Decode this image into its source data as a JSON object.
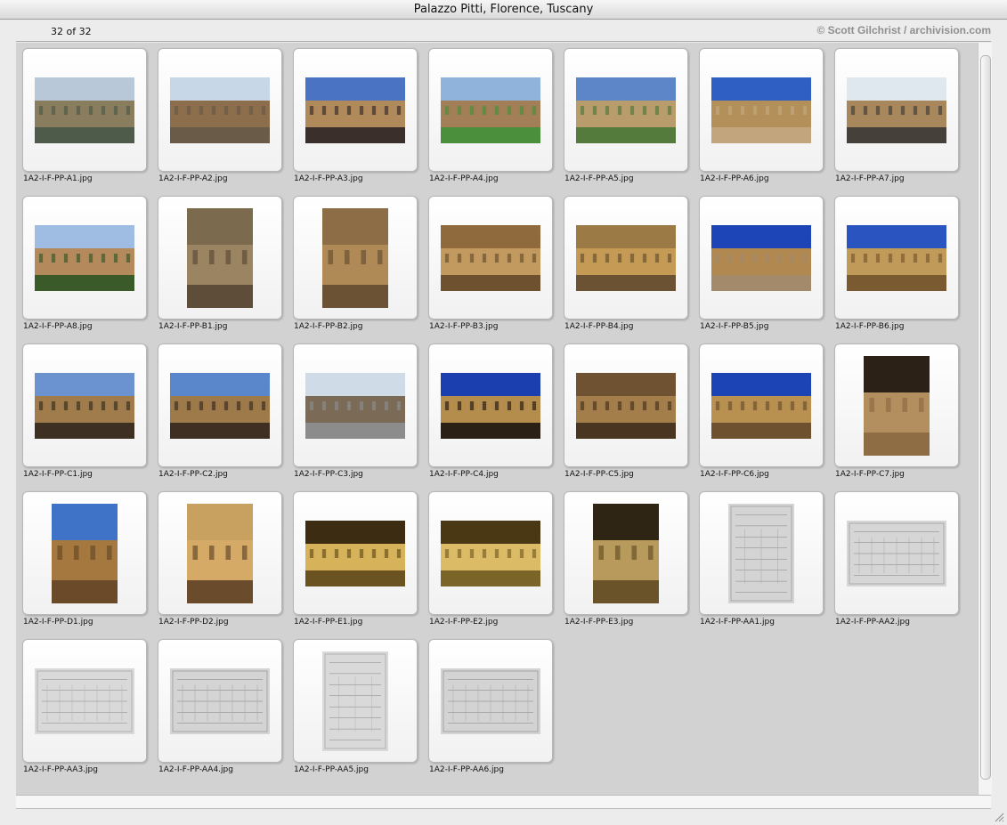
{
  "window": {
    "title": "Palazzo Pitti, Florence, Tuscany"
  },
  "header": {
    "count": "32 of 32",
    "copyright": "© Scott Gilchrist / archivision.com"
  },
  "thumbnails": [
    {
      "filename": "1A2-I-F-PP-A1.jpg",
      "kind": "photo",
      "orientation": "landscape",
      "sky": "#b9c8d8",
      "ground": "#4f5b4a",
      "accent": "#8a7d5e",
      "icon": "city-panorama-icon"
    },
    {
      "filename": "1A2-I-F-PP-A2.jpg",
      "kind": "photo",
      "orientation": "landscape",
      "sky": "#c7d7e7",
      "ground": "#6a5a48",
      "accent": "#8d6e4c",
      "icon": "palace-street-icon"
    },
    {
      "filename": "1A2-I-F-PP-A3.jpg",
      "kind": "photo",
      "orientation": "landscape",
      "sky": "#4a73c4",
      "ground": "#3b2f2b",
      "accent": "#b08a5b",
      "icon": "piazza-facade-icon"
    },
    {
      "filename": "1A2-I-F-PP-A4.jpg",
      "kind": "photo",
      "orientation": "landscape",
      "sky": "#8fb3db",
      "ground": "#4b8f3d",
      "accent": "#a27f56",
      "icon": "palace-garden-icon"
    },
    {
      "filename": "1A2-I-F-PP-A5.jpg",
      "kind": "photo",
      "orientation": "landscape",
      "sky": "#5d86c9",
      "ground": "#547a3c",
      "accent": "#b89c6c",
      "icon": "city-view-icon"
    },
    {
      "filename": "1A2-I-F-PP-A6.jpg",
      "kind": "photo",
      "orientation": "landscape",
      "sky": "#2f5fc2",
      "ground": "#c2a57c",
      "accent": "#b38f59",
      "icon": "palace-courtyard-icon"
    },
    {
      "filename": "1A2-I-F-PP-A7.jpg",
      "kind": "photo",
      "orientation": "landscape",
      "sky": "#dfe8ee",
      "ground": "#45403a",
      "accent": "#a8875d",
      "icon": "palace-wing-icon"
    },
    {
      "filename": "1A2-I-F-PP-A8.jpg",
      "kind": "photo",
      "orientation": "landscape",
      "sky": "#9fbde3",
      "ground": "#3b5a2a",
      "accent": "#b48a5c",
      "icon": "palace-hillside-icon"
    },
    {
      "filename": "1A2-I-F-PP-B1.jpg",
      "kind": "photo",
      "orientation": "portrait",
      "sky": "#7c6a4e",
      "ground": "#5e4d38",
      "accent": "#9a8461",
      "icon": "rusticated-wall-icon"
    },
    {
      "filename": "1A2-I-F-PP-B2.jpg",
      "kind": "photo",
      "orientation": "portrait",
      "sky": "#8c6d45",
      "ground": "#6b5234",
      "accent": "#b08a56",
      "icon": "window-detail-icon"
    },
    {
      "filename": "1A2-I-F-PP-B3.jpg",
      "kind": "photo",
      "orientation": "landscape",
      "sky": "#8e6a3d",
      "ground": "#6e5230",
      "accent": "#c29a5f",
      "icon": "lion-head-icon"
    },
    {
      "filename": "1A2-I-F-PP-B4.jpg",
      "kind": "photo",
      "orientation": "landscape",
      "sky": "#9c7a46",
      "ground": "#6b5232",
      "accent": "#c49a55",
      "icon": "arched-window-icon"
    },
    {
      "filename": "1A2-I-F-PP-B5.jpg",
      "kind": "photo",
      "orientation": "landscape",
      "sky": "#1e45b8",
      "ground": "#a38a6a",
      "accent": "#b08850",
      "icon": "loggia-icon"
    },
    {
      "filename": "1A2-I-F-PP-B6.jpg",
      "kind": "photo",
      "orientation": "landscape",
      "sky": "#2a55c0",
      "ground": "#7a5a30",
      "accent": "#c09a58",
      "icon": "arches-detail-icon"
    },
    {
      "filename": "1A2-I-F-PP-C1.jpg",
      "kind": "photo",
      "orientation": "landscape",
      "sky": "#6a93cf",
      "ground": "#3d2f22",
      "accent": "#a07c4c",
      "icon": "courtyard-icon"
    },
    {
      "filename": "1A2-I-F-PP-C2.jpg",
      "kind": "photo",
      "orientation": "landscape",
      "sky": "#5a86cc",
      "ground": "#3e2f22",
      "accent": "#9e7a4a",
      "icon": "courtyard-icon"
    },
    {
      "filename": "1A2-I-F-PP-C3.jpg",
      "kind": "photo",
      "orientation": "landscape",
      "sky": "#cfdbe6",
      "ground": "#8c8c8c",
      "accent": "#7a6a56",
      "icon": "courtyard-grotto-icon"
    },
    {
      "filename": "1A2-I-F-PP-C4.jpg",
      "kind": "photo",
      "orientation": "landscape",
      "sky": "#1b3fae",
      "ground": "#2a2016",
      "accent": "#b48c4c",
      "icon": "facade-arcade-icon"
    },
    {
      "filename": "1A2-I-F-PP-C5.jpg",
      "kind": "photo",
      "orientation": "landscape",
      "sky": "#6e5232",
      "ground": "#4a3620",
      "accent": "#a37e4a",
      "icon": "rustication-detail-icon"
    },
    {
      "filename": "1A2-I-F-PP-C6.jpg",
      "kind": "photo",
      "orientation": "landscape",
      "sky": "#1c44b4",
      "ground": "#6e5230",
      "accent": "#b8904f",
      "icon": "facade-detail-icon"
    },
    {
      "filename": "1A2-I-F-PP-C7.jpg",
      "kind": "photo",
      "orientation": "portrait",
      "sky": "#2b2117",
      "ground": "#8e6c44",
      "accent": "#b38e5e",
      "icon": "banded-column-icon"
    },
    {
      "filename": "1A2-I-F-PP-D1.jpg",
      "kind": "photo",
      "orientation": "portrait",
      "sky": "#3f73c8",
      "ground": "#6a4a28",
      "accent": "#a4783f",
      "icon": "facade-corner-icon"
    },
    {
      "filename": "1A2-I-F-PP-D2.jpg",
      "kind": "photo",
      "orientation": "portrait",
      "sky": "#c8a060",
      "ground": "#6a4c2c",
      "accent": "#d4aa66",
      "icon": "facade-perspective-icon"
    },
    {
      "filename": "1A2-I-F-PP-E1.jpg",
      "kind": "photo",
      "orientation": "landscape",
      "sky": "#3b2c12",
      "ground": "#6a5320",
      "accent": "#d6b35a",
      "icon": "grotto-statue-icon"
    },
    {
      "filename": "1A2-I-F-PP-E2.jpg",
      "kind": "photo",
      "orientation": "landscape",
      "sky": "#4a3815",
      "ground": "#7a6428",
      "accent": "#dcbb66",
      "icon": "grotto-statue-icon"
    },
    {
      "filename": "1A2-I-F-PP-E3.jpg",
      "kind": "photo",
      "orientation": "portrait",
      "sky": "#2e2514",
      "ground": "#6a5328",
      "accent": "#b89a5c",
      "icon": "grotto-interior-icon"
    },
    {
      "filename": "1A2-I-F-PP-AA1.jpg",
      "kind": "drawing",
      "orientation": "portrait",
      "sky": "#d4d4d4",
      "ground": "#a7a7a7",
      "accent": "#6f6f6f",
      "icon": "plan-engraving-icon"
    },
    {
      "filename": "1A2-I-F-PP-AA2.jpg",
      "kind": "drawing",
      "orientation": "landscape",
      "sky": "#d6d6d6",
      "ground": "#a9a9a9",
      "accent": "#6b6b6b",
      "icon": "view-engraving-icon"
    },
    {
      "filename": "1A2-I-F-PP-AA3.jpg",
      "kind": "drawing",
      "orientation": "landscape",
      "sky": "#d9d9d9",
      "ground": "#b1b1b1",
      "accent": "#707070",
      "icon": "elevation-engraving-icon"
    },
    {
      "filename": "1A2-I-F-PP-AA4.jpg",
      "kind": "drawing",
      "orientation": "landscape",
      "sky": "#d4d4d4",
      "ground": "#a6a6a6",
      "accent": "#676767",
      "icon": "facade-engraving-icon"
    },
    {
      "filename": "1A2-I-F-PP-AA5.jpg",
      "kind": "drawing",
      "orientation": "portrait",
      "sky": "#d9d9d9",
      "ground": "#b2b2b2",
      "accent": "#6f6f6f",
      "icon": "section-engraving-icon"
    },
    {
      "filename": "1A2-I-F-PP-AA6.jpg",
      "kind": "drawing",
      "orientation": "landscape",
      "sky": "#d3d3d3",
      "ground": "#a6a6a6",
      "accent": "#686868",
      "icon": "facade-engraving-icon"
    }
  ]
}
